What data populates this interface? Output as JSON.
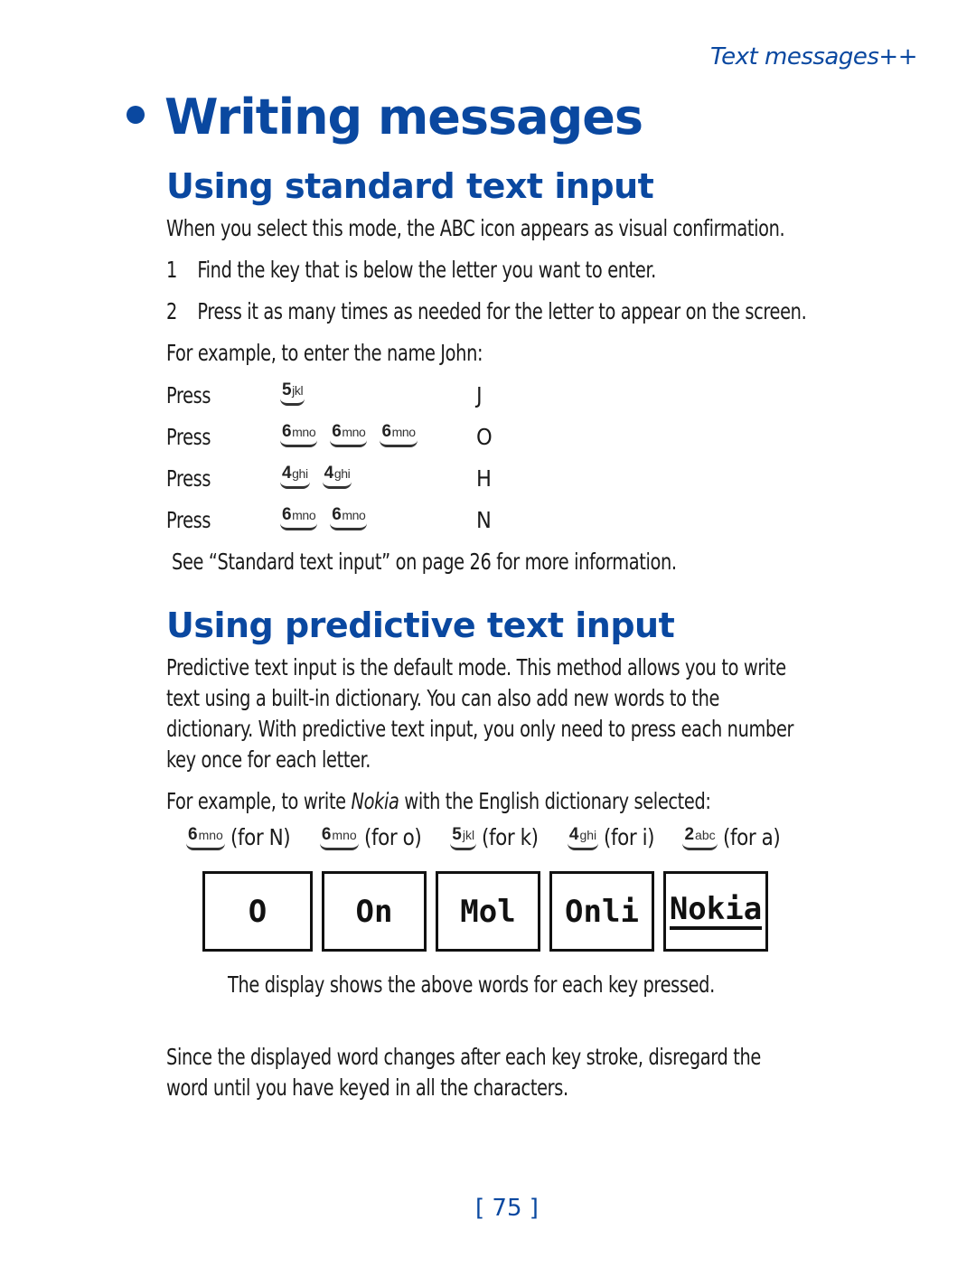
{
  "running_head": "Text messages++",
  "title": "Writing messages",
  "section1": {
    "heading": "Using standard text input",
    "intro": "When you select this mode, the ABC icon appears as visual confirmation.",
    "steps": [
      {
        "num": "1",
        "text": "Find the key that is below the letter you want to enter."
      },
      {
        "num": "2",
        "text": "Press it as many times as needed for the letter to appear on the screen."
      }
    ],
    "example_intro": "For example, to enter the name John:",
    "press_rows": [
      {
        "label": "Press",
        "keys": [
          {
            "digit": "5",
            "letters": "jkl"
          }
        ],
        "result": "J"
      },
      {
        "label": "Press",
        "keys": [
          {
            "digit": "6",
            "letters": "mno"
          },
          {
            "digit": "6",
            "letters": "mno"
          },
          {
            "digit": "6",
            "letters": "mno"
          }
        ],
        "result": "O"
      },
      {
        "label": "Press",
        "keys": [
          {
            "digit": "4",
            "letters": "ghi"
          },
          {
            "digit": "4",
            "letters": "ghi"
          }
        ],
        "result": "H"
      },
      {
        "label": "Press",
        "keys": [
          {
            "digit": "6",
            "letters": "mno"
          },
          {
            "digit": "6",
            "letters": "mno"
          }
        ],
        "result": "N"
      }
    ],
    "see_also": "See “Standard text input” on page 26 for more information."
  },
  "section2": {
    "heading": "Using predictive text input",
    "para_lines": [
      "Predictive text input is the default mode. This method allows you to write",
      "text using a built-in dictionary. You can also add new words to the",
      "dictionary. With predictive text input, you only need to press each number",
      "key once for each letter."
    ],
    "example_prefix": "For example, to write ",
    "example_word": "Nokia",
    "example_suffix": " with the English dictionary selected:",
    "key_sequence": [
      {
        "digit": "6",
        "letters": "mno",
        "note": "(for N)"
      },
      {
        "digit": "6",
        "letters": "mno",
        "note": "(for o)"
      },
      {
        "digit": "5",
        "letters": "jkl",
        "note": "(for k)"
      },
      {
        "digit": "4",
        "letters": "ghi",
        "note": "(for i)"
      },
      {
        "digit": "2",
        "letters": "abc",
        "note": "(for a)"
      }
    ],
    "display_words": [
      "O",
      "On",
      "Mol",
      "Onli",
      "Nokia"
    ],
    "display_caption": "The display shows the above words for each key pressed.",
    "closing_lines": [
      "Since the displayed word changes after each key stroke, disregard the",
      "word until you have keyed in all the characters."
    ]
  },
  "page_number": "[ 75 ]"
}
